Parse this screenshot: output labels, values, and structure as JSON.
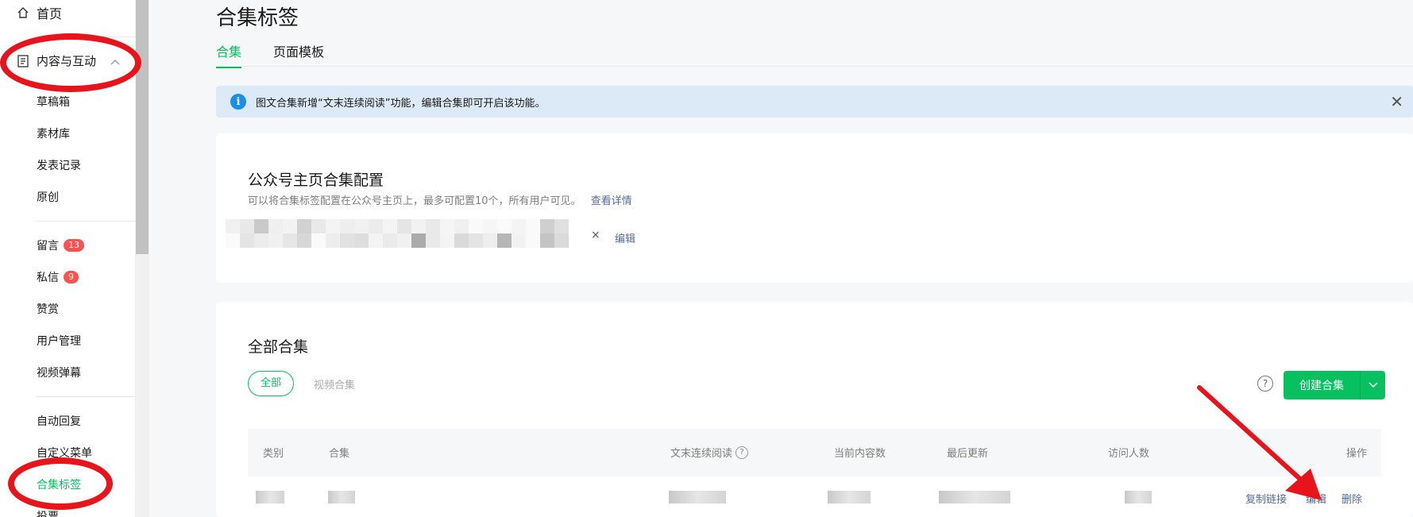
{
  "sidebar": {
    "home": "首页",
    "content_interaction": "内容与互动",
    "items": {
      "drafts": "草稿箱",
      "materials": "素材库",
      "publish_records": "发表记录",
      "original": "原创",
      "comments": "留言",
      "comments_badge": "13",
      "messages": "私信",
      "messages_badge": "9",
      "rewards": "赞赏",
      "user_management": "用户管理",
      "video_danmaku": "视频弹幕",
      "auto_reply": "自动回复",
      "custom_menu": "自定义菜单",
      "collection_tags": "合集标签",
      "vote": "投票"
    }
  },
  "page": {
    "title": "合集标签",
    "tabs": [
      "合集",
      "页面模板"
    ]
  },
  "notice": {
    "text": "图文合集新增“文末连续阅读”功能，编辑合集即可开启该功能。"
  },
  "homepage_config": {
    "title": "公众号主页合集配置",
    "desc": "可以将合集标签配置在公众号主页上，最多可配置10个，所有用户可见。",
    "link": "查看详情",
    "edit": "编辑"
  },
  "all_collections": {
    "title": "全部合集",
    "filters": [
      "全部",
      "视频合集"
    ],
    "help": "?",
    "create_button": "创建合集",
    "table": {
      "headers": {
        "category": "类别",
        "collection": "合集",
        "continuous_reading": "文末连续阅读",
        "content_count": "当前内容数",
        "last_update": "最后更新",
        "visitors": "访问人数",
        "actions": "操作"
      },
      "row_actions": {
        "copy_link": "复制链接",
        "edit": "编辑",
        "delete": "删除"
      }
    }
  },
  "colors": {
    "accent": "#07c160",
    "link": "#576b95",
    "annotation": "#e8141b",
    "notice_bg": "#dbeaf6"
  }
}
